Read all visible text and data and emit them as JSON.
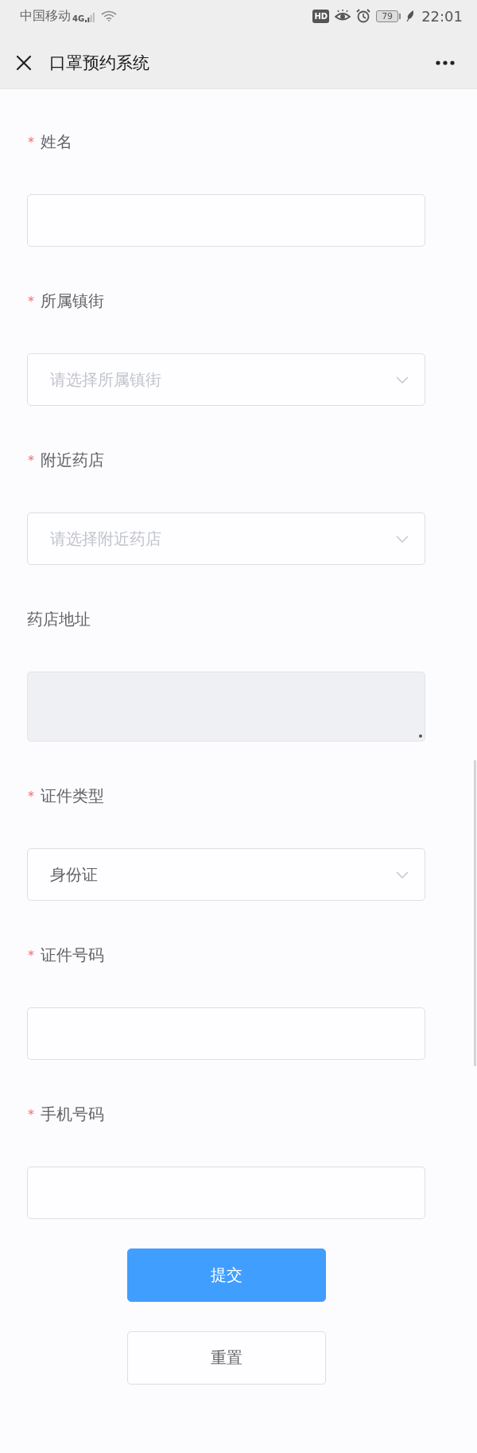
{
  "status_bar": {
    "carrier": "中国移动",
    "network": "4G",
    "hd_badge": "HD",
    "battery": "79",
    "time": "22:01"
  },
  "header": {
    "title": "口罩预约系统"
  },
  "form": {
    "fields": [
      {
        "kind": "input",
        "required_mark": "*",
        "label": "姓名",
        "disabled": false
      },
      {
        "kind": "select",
        "required_mark": "*",
        "label": "所属镇街",
        "placeholder": "请选择所属镇街",
        "disabled": false
      },
      {
        "kind": "select",
        "required_mark": "*",
        "label": "附近药店",
        "placeholder": "请选择附近药店",
        "disabled": false
      },
      {
        "kind": "textarea",
        "label": "药店地址",
        "disabled": true
      },
      {
        "kind": "select",
        "required_mark": "*",
        "label": "证件类型",
        "value": "身份证",
        "disabled": false
      },
      {
        "kind": "input",
        "required_mark": "*",
        "label": "证件号码",
        "disabled": false
      },
      {
        "kind": "input",
        "required_mark": "*",
        "label": "手机号码",
        "disabled": false
      }
    ],
    "buttons": [
      {
        "kind": "primary",
        "label": "提交"
      },
      {
        "kind": "default",
        "label": "重置"
      }
    ]
  }
}
